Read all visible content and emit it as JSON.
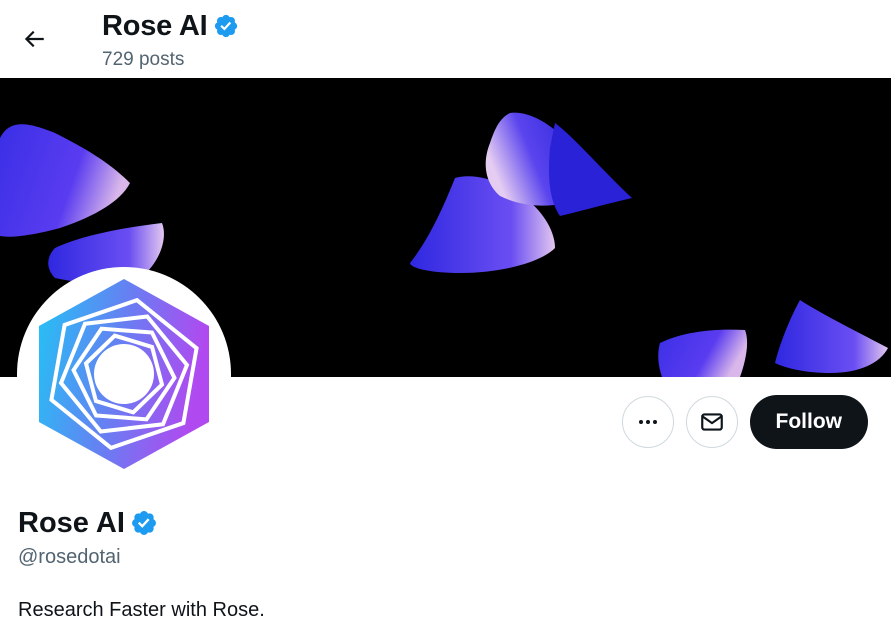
{
  "header": {
    "name": "Rose AI",
    "posts_count": "729 posts"
  },
  "profile": {
    "name": "Rose AI",
    "handle": "@rosedotai",
    "bio": "Research Faster with Rose."
  },
  "actions": {
    "follow_label": "Follow"
  },
  "icons": {
    "back": "arrow-left-icon",
    "verified": "verified-badge-icon",
    "more": "more-horizontal-icon",
    "message": "envelope-icon"
  },
  "colors": {
    "verified_blue": "#1d9bf0",
    "follow_bg": "#0f1419",
    "secondary_text": "#536471",
    "banner_bg": "#000000"
  }
}
